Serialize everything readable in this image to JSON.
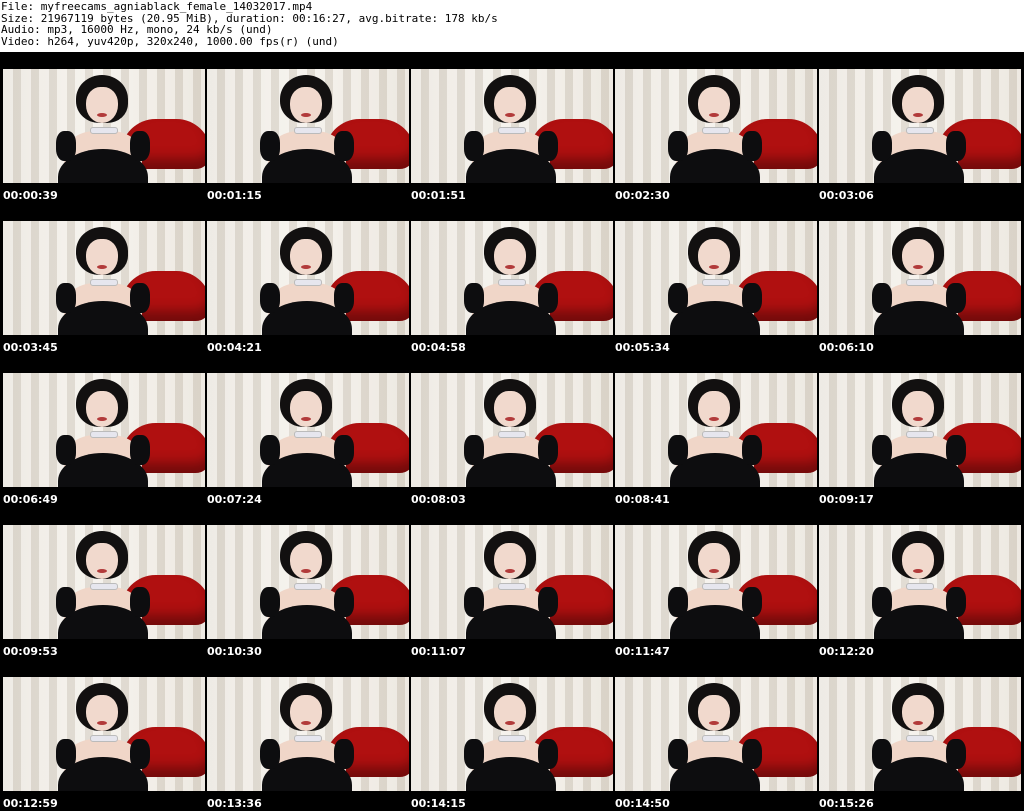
{
  "header": {
    "file_line": "File: myfreecams_agniablack_female_14032017.mp4",
    "size_line": "Size: 21967119 bytes (20.95 MiB), duration: 00:16:27, avg.bitrate: 178 kb/s",
    "audio_line": "Audio: mp3, 16000 Hz, mono, 24 kb/s (und)",
    "video_line": "Video: h264, yuv420p, 320x240, 1000.00 fps(r) (und)"
  },
  "thumbnails": [
    {
      "time": "00:00:39"
    },
    {
      "time": "00:01:15"
    },
    {
      "time": "00:01:51"
    },
    {
      "time": "00:02:30"
    },
    {
      "time": "00:03:06"
    },
    {
      "time": "00:03:45"
    },
    {
      "time": "00:04:21"
    },
    {
      "time": "00:04:58"
    },
    {
      "time": "00:05:34"
    },
    {
      "time": "00:06:10"
    },
    {
      "time": "00:06:49"
    },
    {
      "time": "00:07:24"
    },
    {
      "time": "00:08:03"
    },
    {
      "time": "00:08:41"
    },
    {
      "time": "00:09:17"
    },
    {
      "time": "00:09:53"
    },
    {
      "time": "00:10:30"
    },
    {
      "time": "00:11:07"
    },
    {
      "time": "00:11:47"
    },
    {
      "time": "00:12:20"
    },
    {
      "time": "00:12:59"
    },
    {
      "time": "00:13:36"
    },
    {
      "time": "00:14:15"
    },
    {
      "time": "00:14:50"
    },
    {
      "time": "00:15:26"
    }
  ]
}
